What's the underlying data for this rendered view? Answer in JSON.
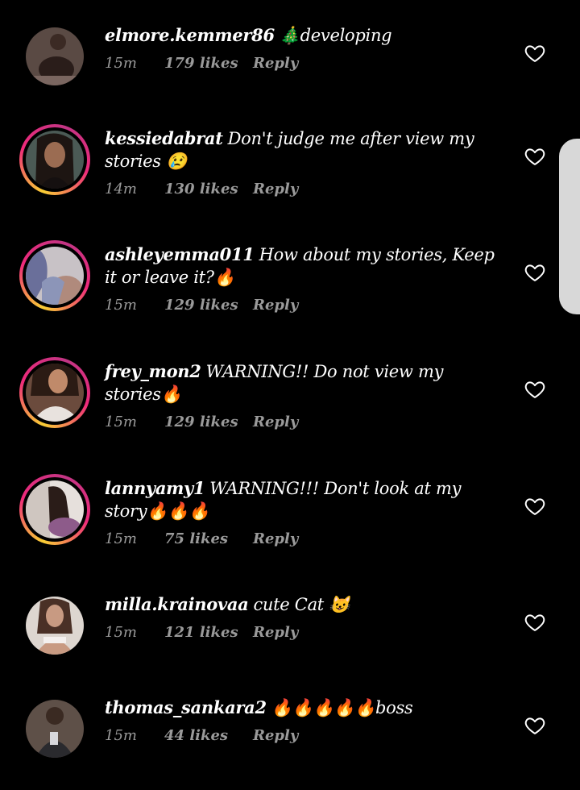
{
  "colors": {
    "background": "#000000",
    "text": "#ffffff",
    "meta": "#9a9a9a",
    "story_ring_start": "#f9ce34",
    "story_ring_end": "#ee2a7b",
    "scroll_handle": "#d8d8d8"
  },
  "comments": [
    {
      "username": "elmore.kemmer86",
      "text": "🎄developing",
      "time": "15m",
      "likes": "179 likes",
      "reply": "Reply",
      "story_ring": false,
      "avatar_icon": "avatar-photo"
    },
    {
      "username": "kessiedabrat",
      "text": "Don't judge me after view my stories 😢",
      "time": "14m",
      "likes": "130 likes",
      "reply": "Reply",
      "story_ring": true,
      "avatar_icon": "avatar-photo"
    },
    {
      "username": "ashleyemma011",
      "text": "How about my stories, Keep it or leave it?🔥",
      "time": "15m",
      "likes": "129 likes",
      "reply": "Reply",
      "story_ring": true,
      "avatar_icon": "avatar-photo"
    },
    {
      "username": "frey_mon2",
      "text": "WARNING!! Do not view my stories🔥",
      "time": "15m",
      "likes": "129 likes",
      "reply": "Reply",
      "story_ring": true,
      "avatar_icon": "avatar-photo"
    },
    {
      "username": "lannyamy1",
      "text": "WARNING!!! Don't look at my story🔥🔥🔥",
      "time": "15m",
      "likes": "75 likes",
      "reply": "Reply",
      "story_ring": true,
      "avatar_icon": "avatar-photo"
    },
    {
      "username": "milla.krainovaa",
      "text": "cute Cat 😺",
      "time": "15m",
      "likes": "121 likes",
      "reply": "Reply",
      "story_ring": false,
      "avatar_icon": "avatar-photo"
    },
    {
      "username": "thomas_sankara2",
      "text": "🔥🔥🔥🔥🔥boss",
      "time": "15m",
      "likes": "44 likes",
      "reply": "Reply",
      "story_ring": false,
      "avatar_icon": "avatar-photo"
    }
  ],
  "like_icon": "heart-outline-icon"
}
